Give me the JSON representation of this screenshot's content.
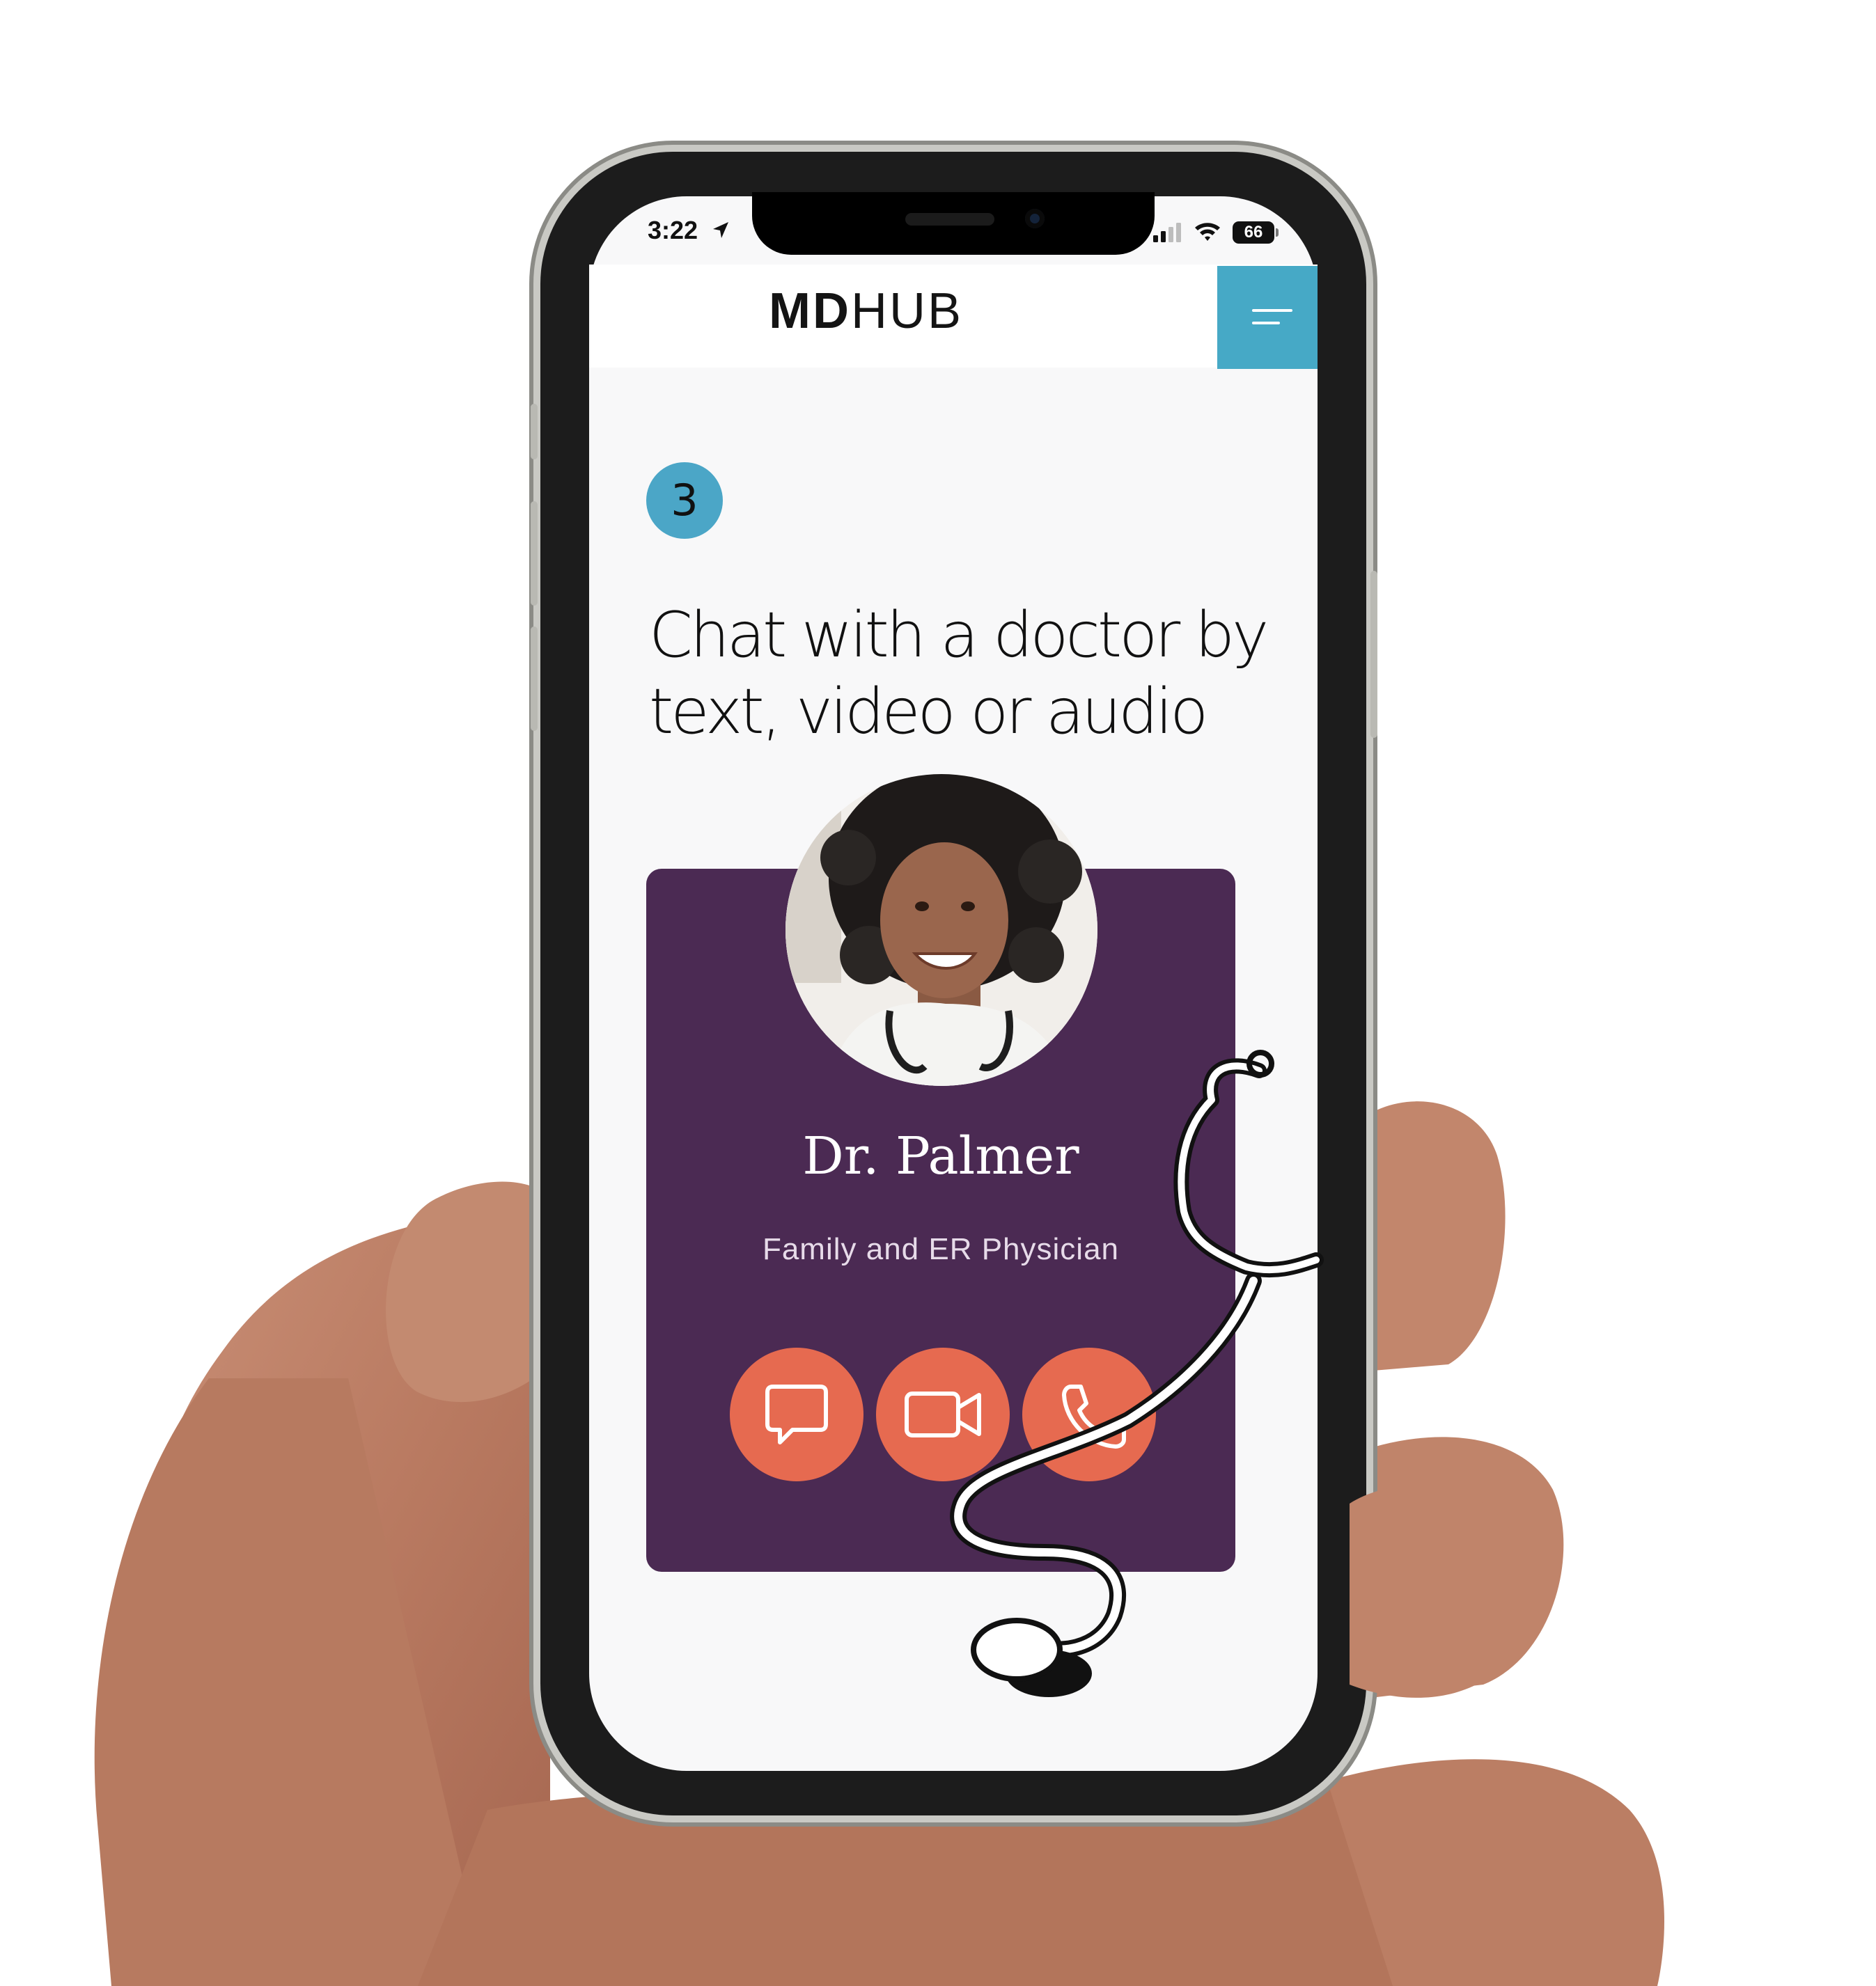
{
  "status_bar": {
    "time": "3:22",
    "battery": "66",
    "icons": [
      "location-arrow-icon",
      "cell-signal-icon",
      "wifi-icon",
      "battery-icon"
    ]
  },
  "header": {
    "logo_bold": "MD",
    "logo_thin": "HUB",
    "menu_icon": "hamburger-menu-icon"
  },
  "step": {
    "number": "3",
    "headline_line1": "Chat with a doctor by",
    "headline_line2": "text, video or audio"
  },
  "doctor": {
    "name": "Dr. Palmer",
    "role": "Family and ER Physician",
    "actions": [
      {
        "icon": "chat-bubble-icon"
      },
      {
        "icon": "video-camera-icon"
      },
      {
        "icon": "phone-icon"
      }
    ]
  },
  "colors": {
    "accent_blue": "#46a9c6",
    "card_purple": "#4b2a53",
    "action_coral": "#e66a50",
    "page_background": "#f8f8f9"
  }
}
